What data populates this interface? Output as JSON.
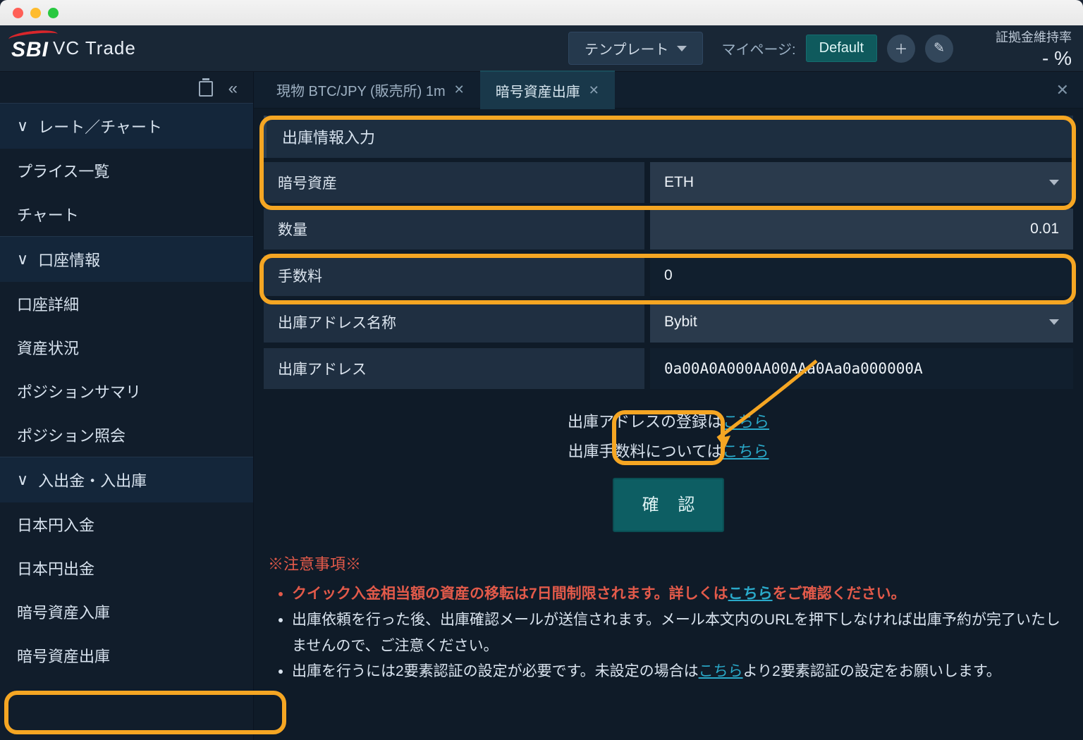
{
  "app": {
    "brand_sbi": "SBI",
    "brand_vc": "VC Trade"
  },
  "topbar": {
    "template_label": "テンプレート",
    "mypage_label": "マイページ:",
    "default_label": "Default",
    "margin_label": "証拠金維持率",
    "margin_value": "- %"
  },
  "sidebar": {
    "sections": [
      {
        "title": "レート／チャート",
        "items": [
          "プライス一覧",
          "チャート"
        ]
      },
      {
        "title": "口座情報",
        "items": [
          "口座詳細",
          "資産状況",
          "ポジションサマリ",
          "ポジション照会"
        ]
      },
      {
        "title": "入出金・入出庫",
        "items": [
          "日本円入金",
          "日本円出金",
          "暗号資産入庫",
          "暗号資産出庫"
        ]
      }
    ]
  },
  "tabs": {
    "inactive": "現物 BTC/JPY (販売所) 1m",
    "active": "暗号資産出庫"
  },
  "form": {
    "header": "出庫情報入力",
    "rows": {
      "asset_label": "暗号資産",
      "asset_value": "ETH",
      "qty_label": "数量",
      "qty_value": "0.01",
      "fee_label": "手数料",
      "fee_value": "0",
      "addrname_label": "出庫アドレス名称",
      "addrname_value": "Bybit",
      "addr_label": "出庫アドレス",
      "addr_value": "0a00A0A000AA00AAa0Aa0a000000A"
    },
    "link_line1_pre": "出庫アドレスの登録は",
    "link_line2_pre": "出庫手数料については",
    "link_text": "こちら",
    "confirm": "確 認",
    "notes_title": "※注意事項※",
    "note1_a": "クイック入金相当額の資産の移転は7日間制限されます。詳しくは",
    "note1_b": "をご確認ください。",
    "note2": "出庫依頼を行った後、出庫確認メールが送信されます。メール本文内のURLを押下しなければ出庫予約が完了いたしませんので、ご注意ください。",
    "note3_a": "出庫を行うには2要素認証の設定が必要です。未設定の場合は",
    "note3_b": "より2要素認証の設定をお願いします。"
  }
}
